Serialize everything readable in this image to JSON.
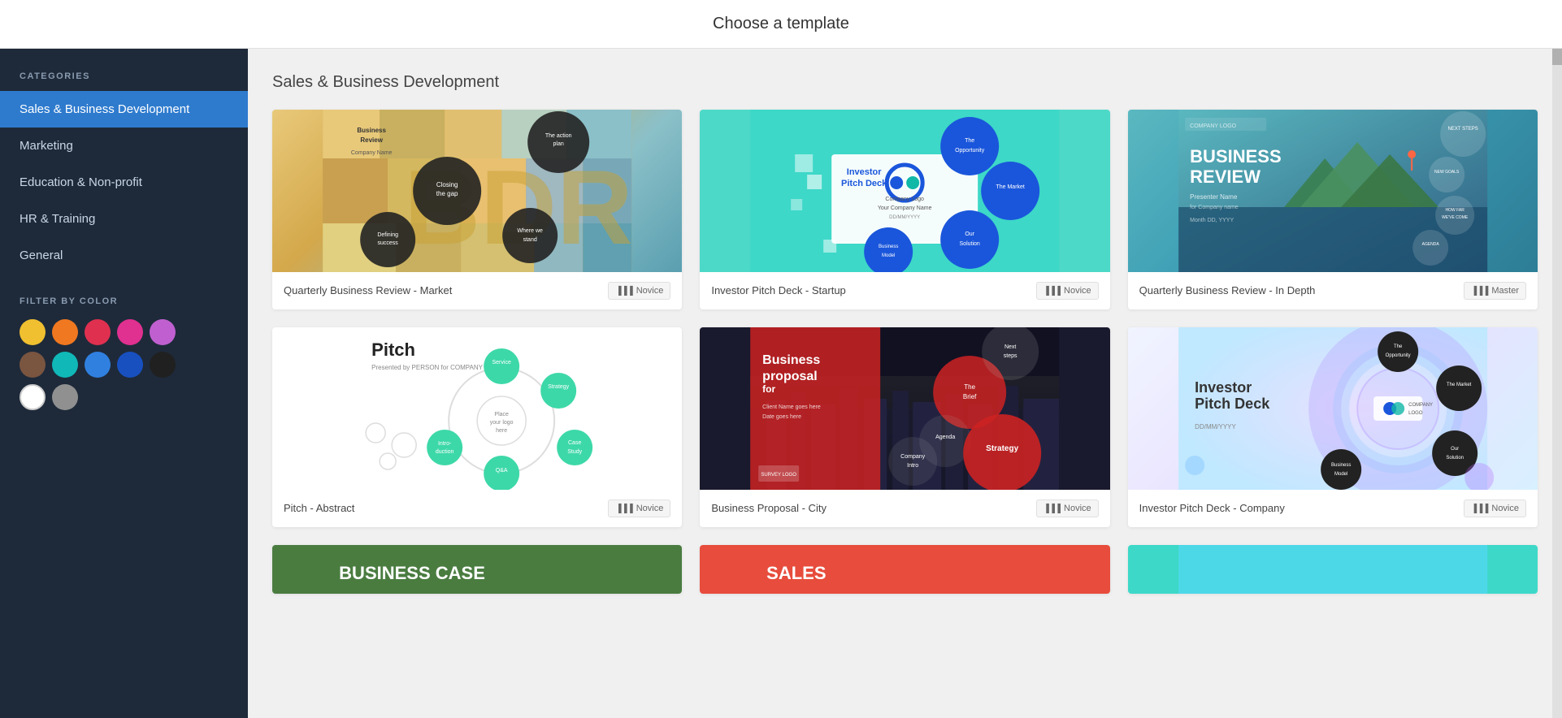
{
  "header": {
    "title": "Choose a template"
  },
  "sidebar": {
    "categories_label": "CATEGORIES",
    "items": [
      {
        "label": "Sales & Business Development",
        "active": true,
        "id": "sales"
      },
      {
        "label": "Marketing",
        "active": false,
        "id": "marketing"
      },
      {
        "label": "Education & Non-profit",
        "active": false,
        "id": "education"
      },
      {
        "label": "HR & Training",
        "active": false,
        "id": "hr"
      },
      {
        "label": "General",
        "active": false,
        "id": "general"
      }
    ],
    "filter_label": "FILTER BY COLOR",
    "colors": [
      {
        "hex": "#f0c030",
        "name": "yellow"
      },
      {
        "hex": "#f07820",
        "name": "orange"
      },
      {
        "hex": "#e03050",
        "name": "red"
      },
      {
        "hex": "#e03090",
        "name": "pink"
      },
      {
        "hex": "#c060d0",
        "name": "purple"
      },
      {
        "hex": "#7a5540",
        "name": "brown"
      },
      {
        "hex": "#10b8b8",
        "name": "teal"
      },
      {
        "hex": "#3080e0",
        "name": "blue"
      },
      {
        "hex": "#1850c0",
        "name": "dark-blue"
      },
      {
        "hex": "#202020",
        "name": "black"
      },
      {
        "hex": "#ffffff",
        "name": "white"
      },
      {
        "hex": "#909090",
        "name": "gray"
      }
    ]
  },
  "content": {
    "section_title": "Sales & Business Development",
    "templates": [
      {
        "id": "qbr-market",
        "name": "Quarterly Business Review - Market",
        "badge": "Novice",
        "thumb_type": "qbr-market"
      },
      {
        "id": "investor-pitch",
        "name": "Investor Pitch Deck - Startup",
        "badge": "Novice",
        "thumb_type": "investor-pitch"
      },
      {
        "id": "qbr-indepth",
        "name": "Quarterly Business Review - In Depth",
        "badge": "Master",
        "thumb_type": "qbr-indepth"
      },
      {
        "id": "pitch-abstract",
        "name": "Pitch - Abstract",
        "badge": "Novice",
        "thumb_type": "pitch-abstract"
      },
      {
        "id": "business-proposal",
        "name": "Business Proposal - City",
        "badge": "Novice",
        "thumb_type": "business-proposal"
      },
      {
        "id": "investor-company",
        "name": "Investor Pitch Deck - Company",
        "badge": "Novice",
        "thumb_type": "investor-company"
      }
    ]
  }
}
